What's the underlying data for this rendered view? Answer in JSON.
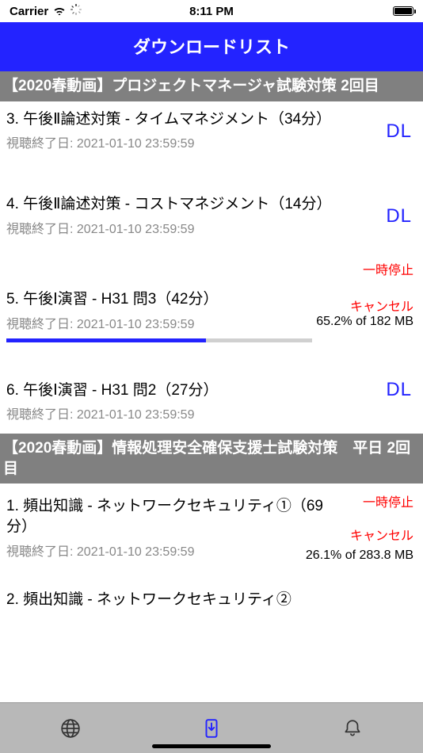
{
  "status": {
    "carrier": "Carrier",
    "time": "8:11 PM"
  },
  "header": {
    "title": "ダウンロードリスト"
  },
  "sections": [
    {
      "title": "【2020春動画】プロジェクトマネージャ試験対策 2回目",
      "items": [
        {
          "title": "3. 午後Ⅱ論述対策 - タイムマネジメント（34分）",
          "sub": "視聴終了日: 2021-01-10 23:59:59",
          "dl": "DL"
        },
        {
          "title": "4. 午後Ⅱ論述対策 - コストマネジメント（14分）",
          "sub": "視聴終了日: 2021-01-10 23:59:59",
          "dl": "DL"
        },
        {
          "title": "5. 午後Ⅰ演習 - H31 問3（42分）",
          "sub": "視聴終了日: 2021-01-10 23:59:59",
          "pause": "一時停止",
          "cancel": "キャンセル",
          "progress_text": "65.2% of 182 MB",
          "progress_pct": 65.2
        },
        {
          "title": "6. 午後Ⅰ演習 - H31 問2（27分）",
          "sub": "視聴終了日: 2021-01-10 23:59:59",
          "dl": "DL"
        }
      ]
    },
    {
      "title": "【2020春動画】情報処理安全確保支援士試験対策　平日 2回目",
      "items": [
        {
          "title": "1. 頻出知識 - ネットワークセキュリティ①（69分）",
          "sub": "視聴終了日: 2021-01-10 23:59:59",
          "pause": "一時停止",
          "cancel": "キャンセル",
          "progress_text": "26.1% of 283.8 MB",
          "progress_pct": 26.1
        },
        {
          "title": "2. 頻出知識 - ネットワークセキュリティ②",
          "sub": "",
          "dl": ""
        }
      ]
    }
  ]
}
